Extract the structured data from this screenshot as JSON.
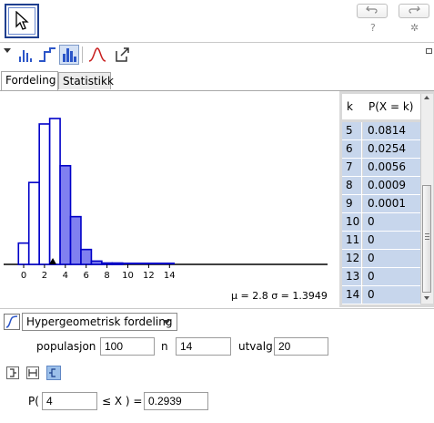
{
  "toolbar": {
    "undo_icon": "undo-icon",
    "redo_icon": "redo-icon",
    "help_label": "?",
    "settings_icon": "gear-icon"
  },
  "tabs": [
    {
      "label": "Fordeling",
      "active": true
    },
    {
      "label": "Statistikk",
      "active": false
    }
  ],
  "chart_data": {
    "type": "bar",
    "x_ticks": [
      0,
      2,
      4,
      6,
      8,
      10,
      12,
      14
    ],
    "xlim": [
      -1,
      15
    ],
    "ylim": [
      0,
      0.27
    ],
    "categories": [
      0,
      1,
      2,
      3,
      4,
      5,
      6,
      7,
      8,
      9,
      10,
      11,
      12,
      13,
      14
    ],
    "values": [
      0.0363,
      0.1397,
      0.2395,
      0.2488,
      0.1683,
      0.0814,
      0.0254,
      0.0056,
      0.0009,
      0.0001,
      0,
      0,
      0,
      0,
      0
    ],
    "highlight_from": 4,
    "marker_x": 2.8,
    "stats": {
      "mu_label": "μ = 2.8",
      "sigma_label": "σ = 1.3949"
    },
    "colors": {
      "highlight": "#8080f0",
      "edge": "#0000c8",
      "normal": "#ffffff"
    }
  },
  "table": {
    "headers": [
      "k",
      "P(X = k)"
    ],
    "rows": [
      {
        "k": "5",
        "p": "0.0814"
      },
      {
        "k": "6",
        "p": "0.0254"
      },
      {
        "k": "7",
        "p": "0.0056"
      },
      {
        "k": "8",
        "p": "0.0009"
      },
      {
        "k": "9",
        "p": "0.0001"
      },
      {
        "k": "10",
        "p": "0"
      },
      {
        "k": "11",
        "p": "0"
      },
      {
        "k": "12",
        "p": "0"
      },
      {
        "k": "13",
        "p": "0"
      },
      {
        "k": "14",
        "p": "0"
      }
    ]
  },
  "controls": {
    "distribution": "Hypergeometrisk fordeling",
    "populasjon_label": "populasjon",
    "populasjon_value": "100",
    "n_label": "n",
    "n_value": "14",
    "utvalg_label": "utvalg",
    "utvalg_value": "20",
    "prob_prefix": "P(",
    "prob_lower": "4",
    "prob_op": "≤ X ) =",
    "prob_result": "0.2939"
  }
}
